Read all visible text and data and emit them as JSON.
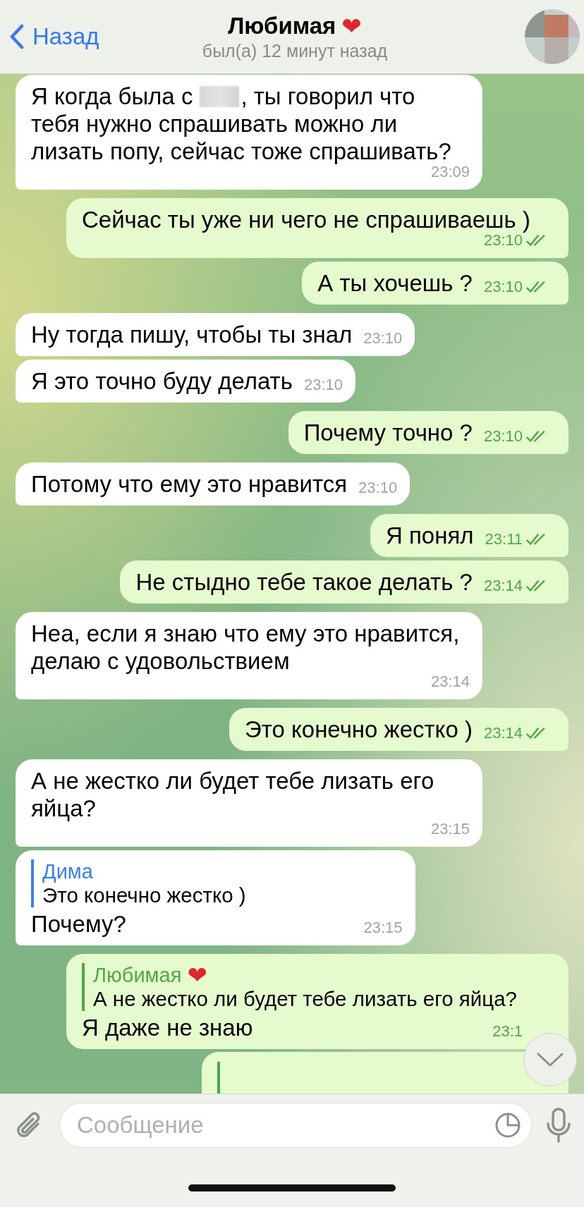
{
  "header": {
    "back_label": "Назад",
    "title": "Любимая",
    "title_emoji": "❤",
    "status": "был(а) 12 минут назад"
  },
  "messages": [
    {
      "kind": "text",
      "outgoing": false,
      "segments": [
        {
          "kind": "text",
          "text": "Я когда была с"
        },
        {
          "kind": "redacted"
        },
        {
          "kind": "text",
          "text": ", ты говорил что тебя нужно спрашивать можно ли лизать попу, сейчас тоже спрашивать?"
        }
      ],
      "time": "23:09"
    },
    {
      "kind": "text",
      "outgoing": true,
      "segments": [
        {
          "kind": "text",
          "text": "Сейчас ты уже ни чего не спрашиваешь )"
        }
      ],
      "time": "23:10",
      "read": true
    },
    {
      "kind": "text",
      "outgoing": true,
      "segments": [
        {
          "kind": "text",
          "text": "А ты хочешь ?"
        }
      ],
      "time": "23:10",
      "read": true
    },
    {
      "kind": "text",
      "outgoing": false,
      "segments": [
        {
          "kind": "text",
          "text": "Ну тогда пишу, чтобы ты знал"
        }
      ],
      "time": "23:10"
    },
    {
      "kind": "text",
      "outgoing": false,
      "segments": [
        {
          "kind": "text",
          "text": "Я это точно буду делать"
        }
      ],
      "time": "23:10"
    },
    {
      "kind": "text",
      "outgoing": true,
      "segments": [
        {
          "kind": "text",
          "text": "Почему точно ?"
        }
      ],
      "time": "23:10",
      "read": true
    },
    {
      "kind": "text",
      "outgoing": false,
      "segments": [
        {
          "kind": "text",
          "text": "Потому что ему это нравится"
        }
      ],
      "time": "23:10"
    },
    {
      "kind": "text",
      "outgoing": true,
      "segments": [
        {
          "kind": "text",
          "text": "Я понял"
        }
      ],
      "time": "23:11",
      "read": true
    },
    {
      "kind": "text",
      "outgoing": true,
      "segments": [
        {
          "kind": "text",
          "text": "Не стыдно тебе такое делать ?"
        }
      ],
      "time": "23:14",
      "read": true
    },
    {
      "kind": "text",
      "outgoing": false,
      "segments": [
        {
          "kind": "text",
          "text": "Неа, если я знаю что ему это нравится, делаю с удовольствием"
        }
      ],
      "time": "23:14"
    },
    {
      "kind": "text",
      "outgoing": true,
      "segments": [
        {
          "kind": "text",
          "text": "Это конечно жестко )"
        }
      ],
      "time": "23:14",
      "read": true
    },
    {
      "kind": "text",
      "outgoing": false,
      "segments": [
        {
          "kind": "text",
          "text": "А не жестко ли будет тебе лизать его яйца?"
        }
      ],
      "time": "23:15"
    },
    {
      "kind": "text",
      "outgoing": false,
      "reply": {
        "name": "Дима",
        "text": "Это конечно жестко )"
      },
      "segments": [
        {
          "kind": "text",
          "text": "Почему?"
        }
      ],
      "time": "23:15"
    },
    {
      "kind": "text",
      "outgoing": true,
      "reply": {
        "name": "Любимая",
        "emoji": "❤",
        "text": "А не жестко ли будет тебе лизать его яйца?"
      },
      "segments": [
        {
          "kind": "text",
          "text": "Я даже не знаю"
        }
      ],
      "time": "23:1"
    },
    {
      "kind": "partial",
      "outgoing": true
    }
  ],
  "composer": {
    "placeholder": "Сообщение"
  }
}
